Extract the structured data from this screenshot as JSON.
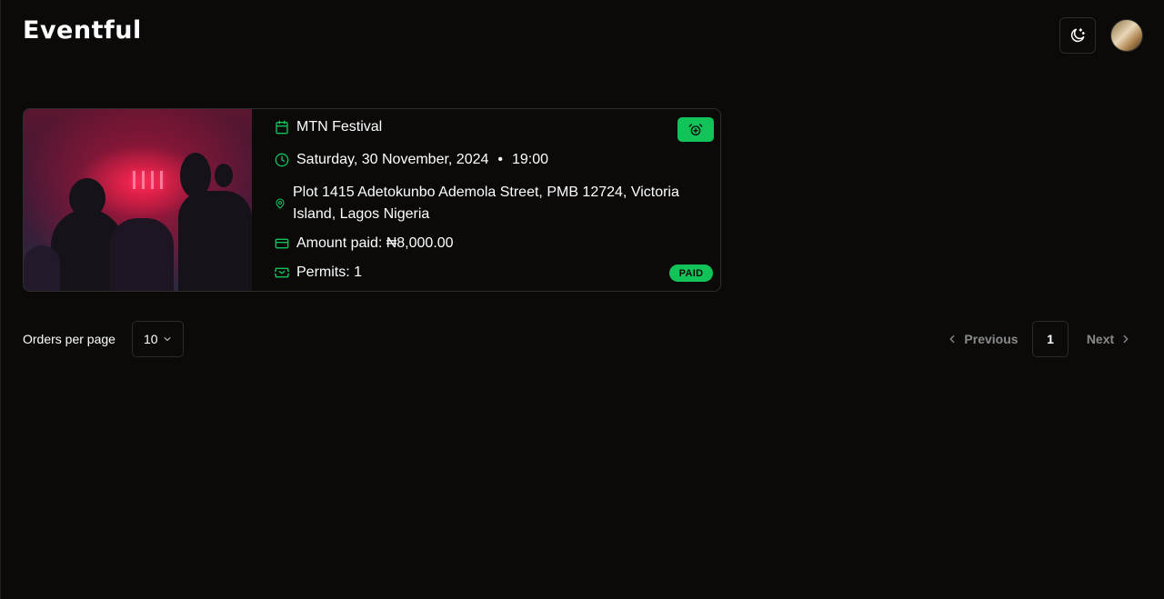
{
  "app": {
    "logo": "Eventful"
  },
  "header": {
    "theme_icon": "moon-stars-icon",
    "avatar_icon": "user-avatar"
  },
  "order": {
    "event_name": "MTN Festival",
    "date": "Saturday, 30 November, 2024",
    "separator": "•",
    "time": "19:00",
    "address": "Plot 1415 Adetokunbo Ademola Street, PMB 12724, Victoria Island, Lagos Nigeria",
    "amount_label": "Amount paid: ₦8,000.00",
    "permits_label": "Permits: 1",
    "status": "PAID",
    "icons": {
      "event": "calendar-icon",
      "date": "clock-icon",
      "address": "map-pin-icon",
      "amount": "credit-card-icon",
      "permits": "ticket-icon",
      "reminder": "alarm-clock-icon"
    }
  },
  "pagination": {
    "per_page_label": "Orders per page",
    "per_page_value": "10",
    "previous": "Previous",
    "current_page": "1",
    "next": "Next"
  },
  "colors": {
    "background": "#0b0a09",
    "accent": "#12c35a",
    "border": "#2b2b2b",
    "muted": "#8a8a8a"
  }
}
